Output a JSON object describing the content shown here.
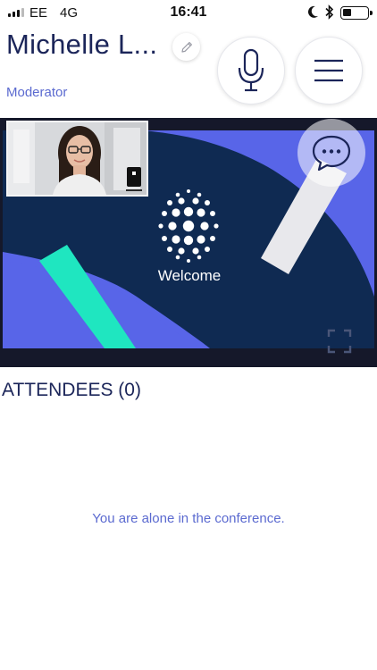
{
  "status_bar": {
    "carrier": "EE",
    "network": "4G",
    "time": "16:41",
    "signal_bars": 3,
    "battery_level": 0.25,
    "icons": [
      "signal-icon",
      "moon-icon",
      "bluetooth-icon",
      "battery-icon"
    ]
  },
  "header": {
    "user_name": "Michelle L...",
    "role": "Moderator",
    "edit_icon": "pencil-icon",
    "mic_icon": "microphone-icon",
    "menu_icon": "hamburger-menu-icon"
  },
  "stage": {
    "slide_text": "Welcome",
    "chat_icon": "chat-bubble-icon",
    "fullscreen_icon": "fullscreen-icon",
    "self_view": "self-camera-preview"
  },
  "attendees": {
    "title": "ATTENDEES (0)",
    "count": 0,
    "empty_message": "You are alone in the conference."
  },
  "colors": {
    "navy": "#1b2559",
    "slide_dark": "#0f2a52",
    "slide_blue": "#5865e8",
    "slide_mint": "#1fe6c0",
    "link_blue": "#5b6ad0"
  }
}
